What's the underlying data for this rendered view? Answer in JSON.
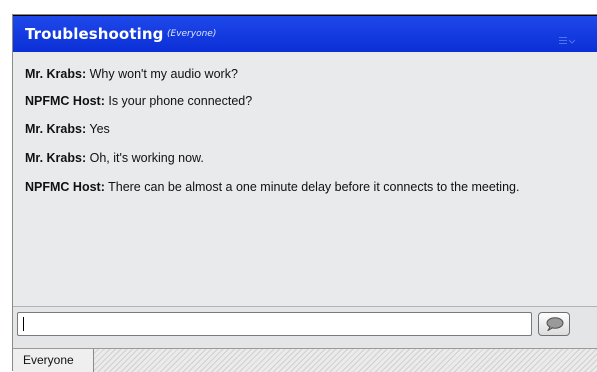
{
  "pod": {
    "title": "Troubleshooting",
    "audience": "(Everyone)",
    "menu_icon": "menu-list-icon"
  },
  "messages": [
    {
      "sender": "Mr. Krabs:",
      "text": "Why won't my audio work?"
    },
    {
      "sender": "NPFMC Host:",
      "text": "Is your phone connected?"
    },
    {
      "sender": "Mr. Krabs:",
      "text": "Yes"
    },
    {
      "sender": "Mr. Krabs:",
      "text": "Oh, it's working now."
    },
    {
      "sender": "NPFMC Host:",
      "text": "There can be almost a one minute  delay before it connects to the meeting."
    }
  ],
  "input": {
    "value": "",
    "placeholder": "",
    "send_icon": "speech-bubble-icon"
  },
  "tabs": [
    {
      "label": "Everyone"
    }
  ],
  "colors": {
    "title_bar": "#0a2fd6",
    "message_area": "#e9eaec"
  }
}
